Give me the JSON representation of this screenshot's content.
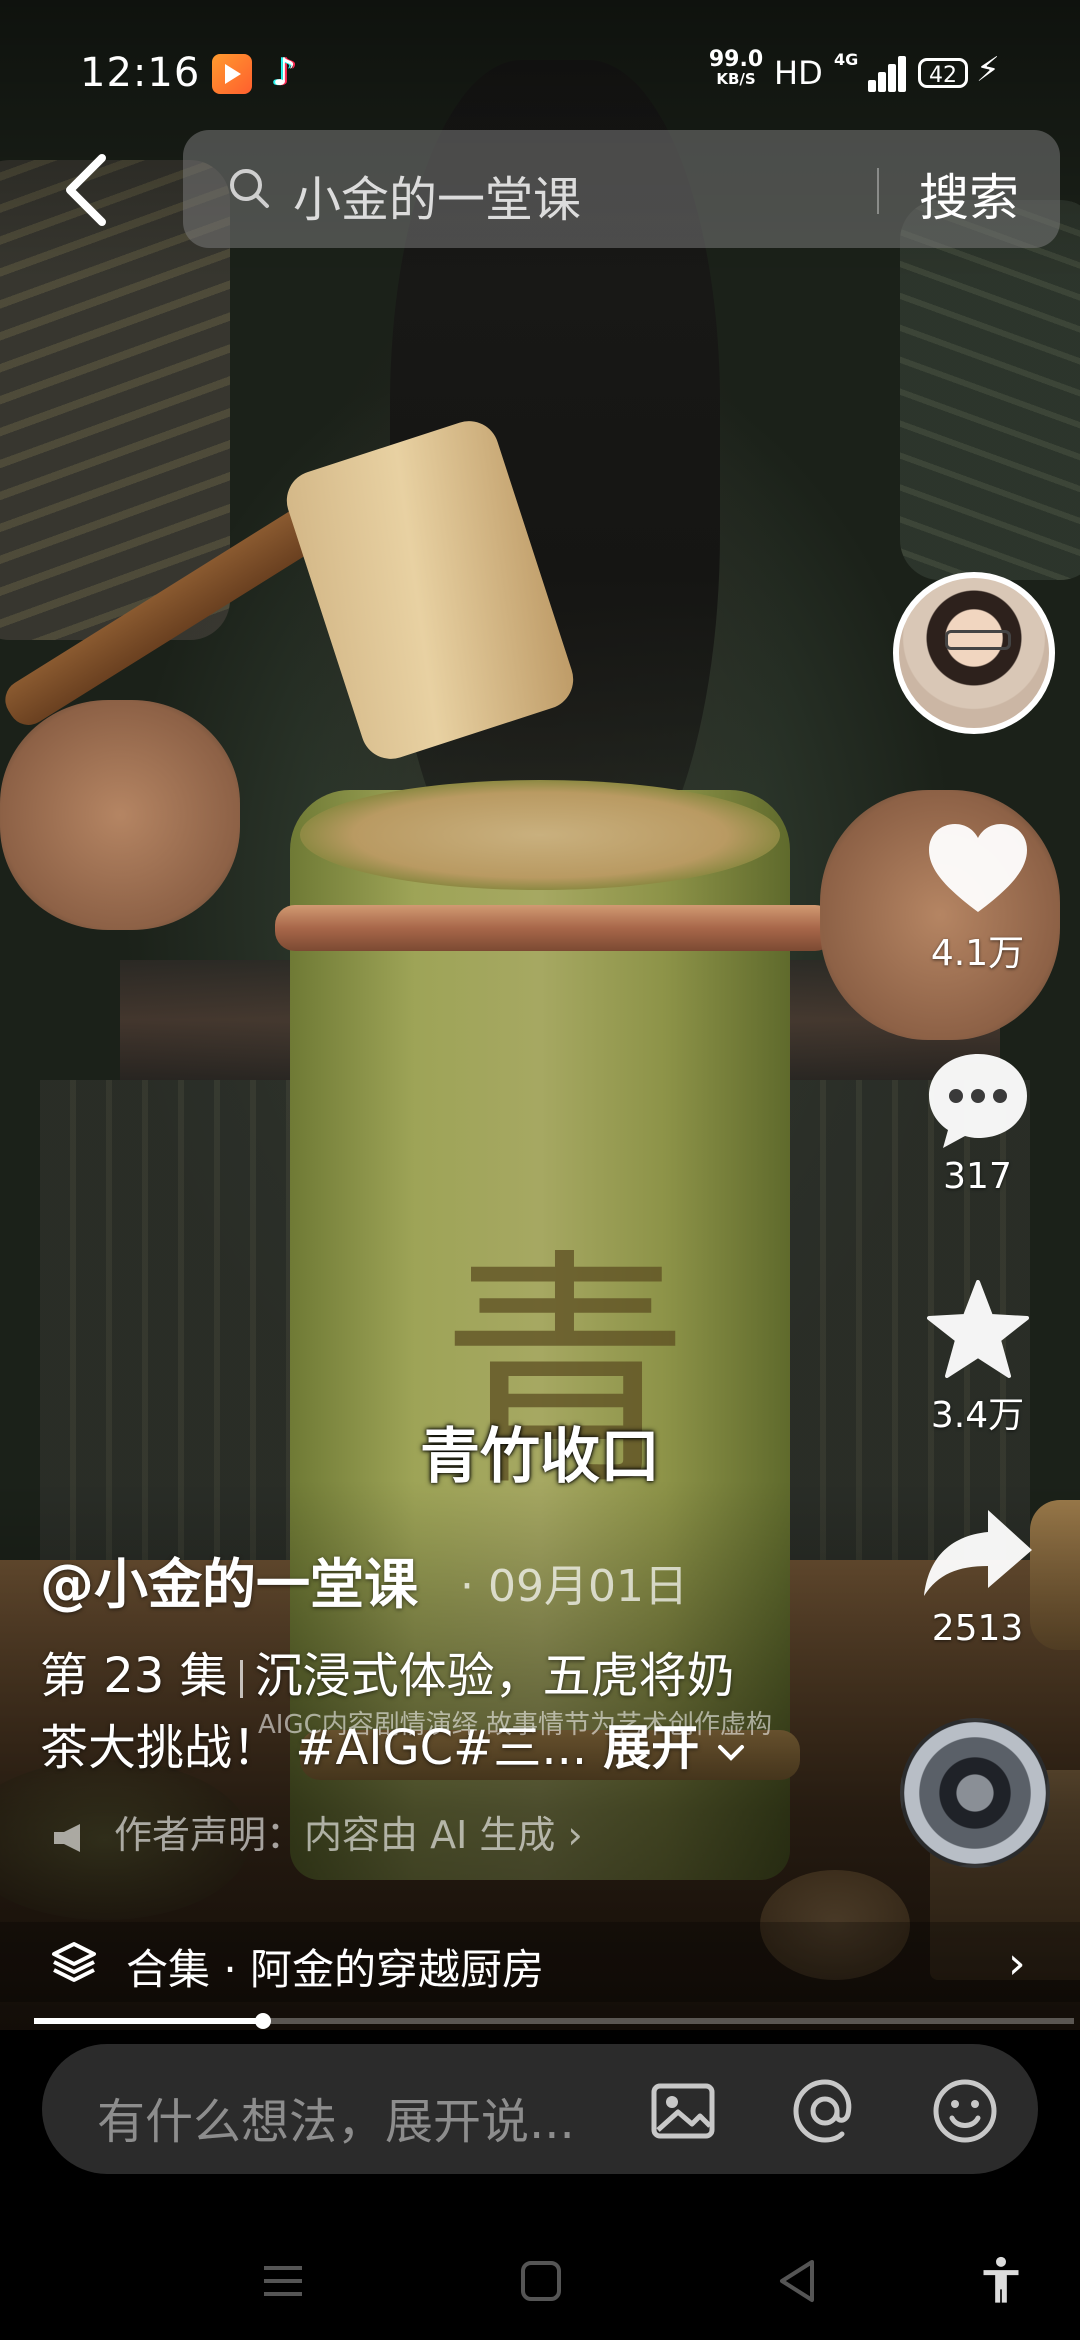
{
  "status_bar": {
    "time": "12:16",
    "net_speed": "99.0",
    "net_unit": "KB/S",
    "hd": "HD",
    "network": "4G",
    "battery": "42",
    "app_icons": [
      "video-app-icon",
      "tiktok-icon"
    ]
  },
  "search": {
    "query": "小金的一堂课",
    "button": "搜索"
  },
  "actions": {
    "likes": "4.1万",
    "comments": "317",
    "favorites": "3.4万",
    "shares": "2513"
  },
  "video": {
    "subtitle": "青竹收口",
    "author": "@小金的一堂课",
    "date": "· 09月01日",
    "episode": "第 23 集",
    "title_line1": "沉浸式体验，五虎将奶",
    "title_line2": "茶大挑战！ #AIGC#三...",
    "expand": "展开",
    "watermark": "AIGC内容剧情演绎 故事情节为艺术创作虚构",
    "declaration": "作者声明：内容由 AI 生成",
    "collection": "合集 · 阿金的穿越厨房",
    "progress": 0.22
  },
  "comment_bar": {
    "placeholder": "有什么想法，展开说..."
  },
  "colors": {
    "accent": "#ffffff",
    "comment_bg": "#2b2b2b",
    "search_bg": "#787878"
  }
}
